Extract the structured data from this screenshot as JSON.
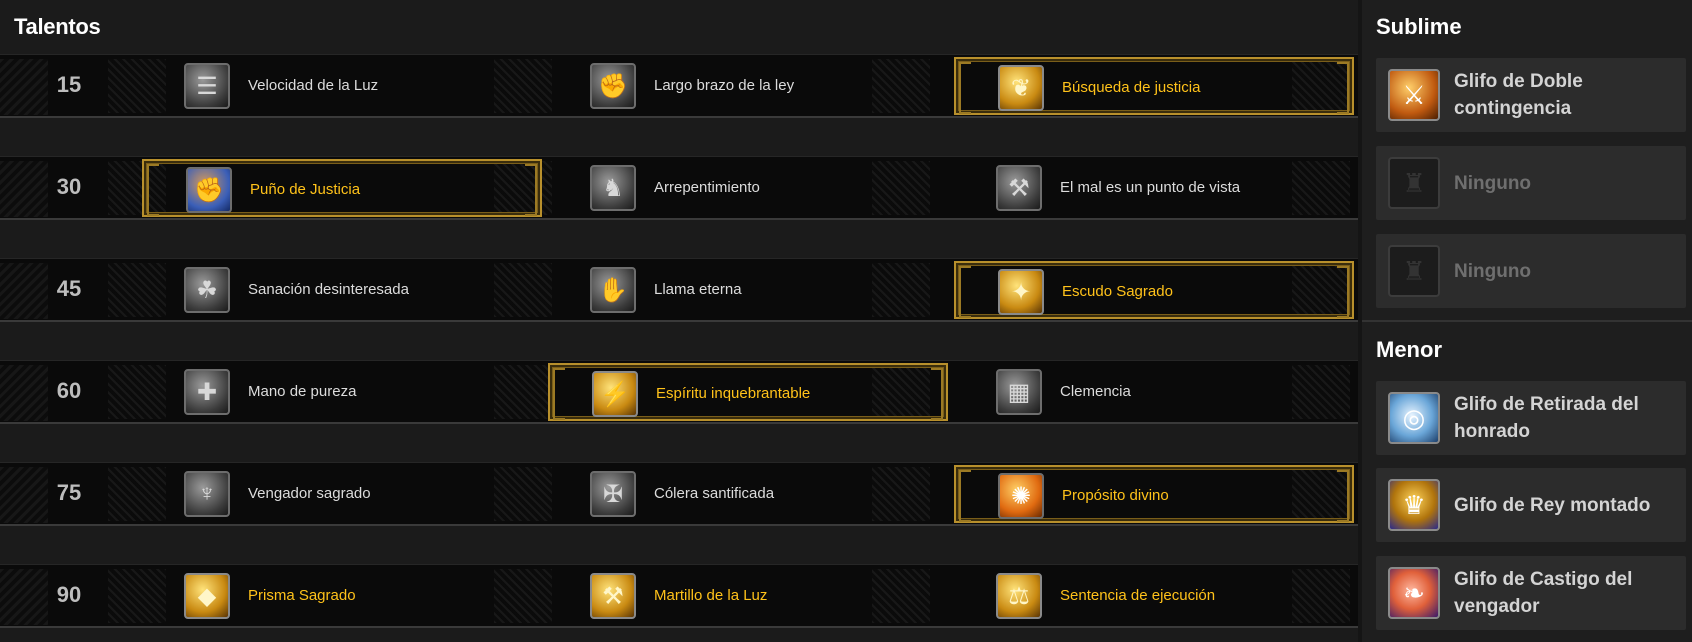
{
  "talents": {
    "title": "Talentos",
    "tiers": [
      {
        "level": "15",
        "options": [
          {
            "label": "Velocidad de la Luz",
            "icon": "speed-icon",
            "selected": false
          },
          {
            "label": "Largo brazo de la ley",
            "icon": "fist-icon",
            "selected": false
          },
          {
            "label": "Búsqueda de justicia",
            "icon": "wings-icon",
            "selected": true
          }
        ]
      },
      {
        "level": "30",
        "options": [
          {
            "label": "Puño de Justicia",
            "icon": "gauntlet-icon",
            "selected": true
          },
          {
            "label": "Arrepentimiento",
            "icon": "kneeling-icon",
            "selected": false
          },
          {
            "label": "El mal es un punto de vista",
            "icon": "hammer-icon",
            "selected": false
          }
        ]
      },
      {
        "level": "45",
        "options": [
          {
            "label": "Sanación desinteresada",
            "icon": "hands-icon",
            "selected": false
          },
          {
            "label": "Llama eterna",
            "icon": "flame-icon",
            "selected": false
          },
          {
            "label": "Escudo Sagrado",
            "icon": "shield-icon",
            "selected": true
          }
        ]
      },
      {
        "level": "60",
        "options": [
          {
            "label": "Mano de pureza",
            "icon": "cross-icon",
            "selected": false
          },
          {
            "label": "Espíritu inquebrantable",
            "icon": "spirit-icon",
            "selected": true
          },
          {
            "label": "Clemencia",
            "icon": "stones-icon",
            "selected": false
          }
        ]
      },
      {
        "level": "75",
        "options": [
          {
            "label": "Vengador sagrado",
            "icon": "angel-icon",
            "selected": false
          },
          {
            "label": "Cólera santificada",
            "icon": "wrath-icon",
            "selected": false
          },
          {
            "label": "Propósito divino",
            "icon": "purpose-icon",
            "selected": true
          }
        ]
      },
      {
        "level": "90",
        "options": [
          {
            "label": "Prisma Sagrado",
            "icon": "prism-icon",
            "selected": false,
            "gold": true
          },
          {
            "label": "Martillo de la Luz",
            "icon": "light-hammer-icon",
            "selected": false,
            "gold": true
          },
          {
            "label": "Sentencia de ejecución",
            "icon": "sentence-icon",
            "selected": false,
            "gold": true
          }
        ]
      }
    ]
  },
  "glyphs": {
    "major_title": "Sublime",
    "minor_title": "Menor",
    "major": [
      {
        "label": "Glifo de Doble contingencia",
        "icon": "double-jeopardy-icon"
      },
      {
        "label": "Ninguno",
        "icon": "empty-glyph-icon",
        "empty": true
      },
      {
        "label": "Ninguno",
        "icon": "empty-glyph-icon",
        "empty": true
      }
    ],
    "minor": [
      {
        "label": "Glifo de Retirada del honrado",
        "icon": "shield-swirl-icon"
      },
      {
        "label": "Glifo de Rey montado",
        "icon": "helmet-icon"
      },
      {
        "label": "Glifo de Castigo del vengador",
        "icon": "feather-icon"
      }
    ]
  },
  "colors": {
    "selected_text": "#ffc21a",
    "selected_border": "#b8902c",
    "text": "#dcdcdc"
  }
}
